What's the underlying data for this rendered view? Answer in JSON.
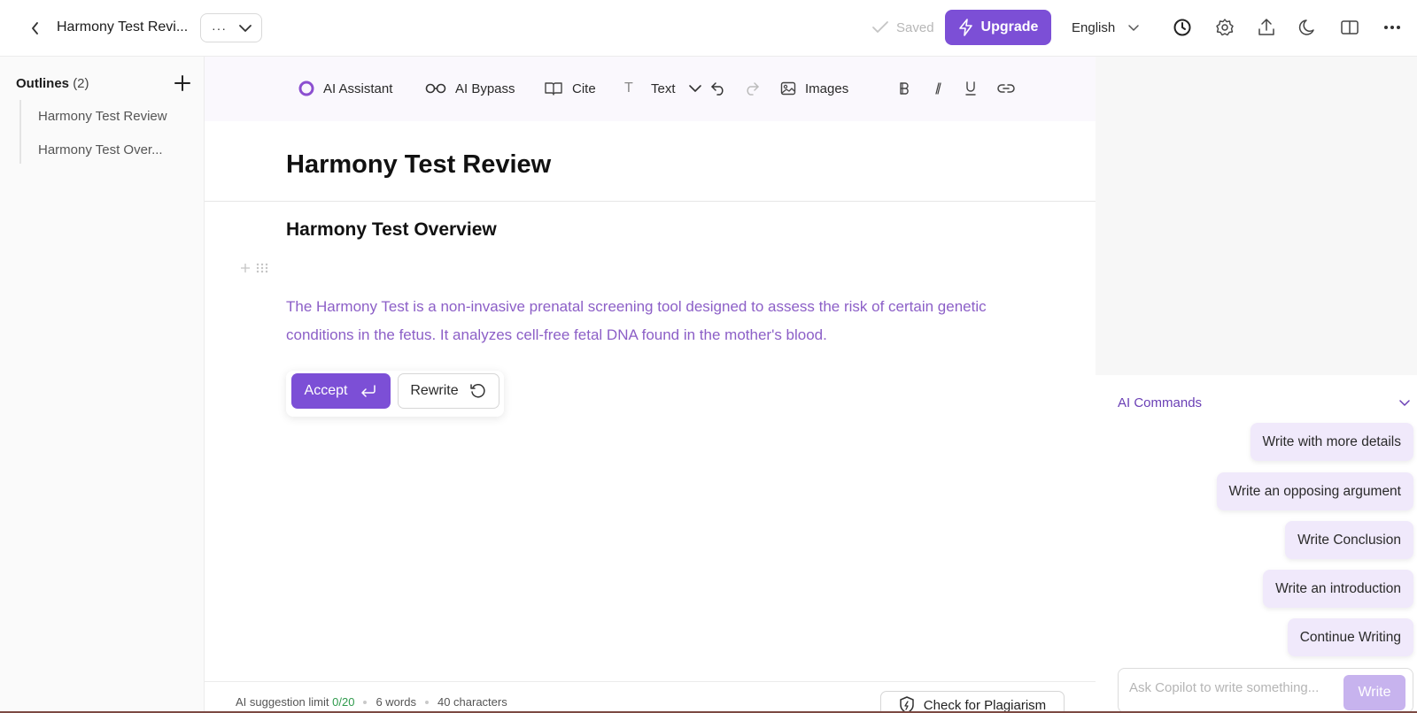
{
  "header": {
    "doc_title": "Harmony Test Revi...",
    "more_label": "···",
    "saved_label": "Saved",
    "upgrade_label": "Upgrade",
    "language": "English"
  },
  "sidebar": {
    "outlines_label": "Outlines",
    "outlines_count": "(2)",
    "items": [
      {
        "label": "Harmony Test Review"
      },
      {
        "label": "Harmony Test Over..."
      }
    ]
  },
  "toolbar": {
    "ai_assistant": "AI Assistant",
    "ai_bypass": "AI Bypass",
    "cite": "Cite",
    "text": "Text",
    "images": "Images"
  },
  "document": {
    "title": "Harmony Test Review",
    "heading": "Harmony Test Overview",
    "suggestion": "The Harmony Test is a non-invasive prenatal screening tool designed to assess the risk of certain genetic conditions in the fetus. It analyzes cell-free fetal DNA found in the mother's blood."
  },
  "suggestion_actions": {
    "accept": "Accept",
    "rewrite": "Rewrite"
  },
  "footer": {
    "limit_label": "AI suggestion limit",
    "limit_value": "0/20",
    "words": "6 words",
    "characters": "40 characters",
    "plagiarism": "Check for Plagiarism"
  },
  "ai_commands": {
    "header": "AI Commands",
    "commands": [
      "Write with more details",
      "Write an opposing argument",
      "Write Conclusion",
      "Write an introduction",
      "Continue Writing"
    ],
    "input_placeholder": "Ask Copilot to write something...",
    "write_label": "Write"
  },
  "colors": {
    "accent": "#7c4fd6",
    "suggestion_text": "#8c5fc7",
    "chip_bg": "#f0e9fb"
  }
}
